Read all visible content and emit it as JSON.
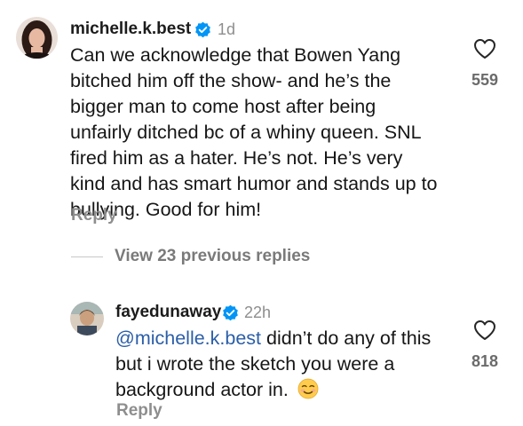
{
  "comments": [
    {
      "username": "michelle.k.best",
      "time": "1d",
      "lines": [
        "Can we acknowledge that Bowen Yang",
        "bitched him off the show- and he’s the",
        "bigger man to come host after being",
        "unfairly ditched bc of a whiny queen.  SNL",
        "fired him as a hater. He’s not. He’s very",
        "kind and has smart humor and stands up to",
        "bullying. Good for him!"
      ],
      "reply_label": "Reply",
      "like_count": "559"
    },
    {
      "username": "fayedunaway",
      "time": "22h",
      "mention": "@michelle.k.best",
      "line1_rest": " didn’t do any of this",
      "line2": "but i wrote the sketch you were a",
      "line3": "background actor in.",
      "emoji": "☺️",
      "reply_label": "Reply",
      "like_count": "818"
    }
  ],
  "view_replies_label": "View 23 previous replies",
  "colors": {
    "verified_badge": "#0095f6",
    "mention": "#2b5ea8",
    "secondary_text": "#8e8e8e"
  },
  "icons": {
    "like": "heart-outline-icon",
    "verified": "verified-badge-icon"
  }
}
